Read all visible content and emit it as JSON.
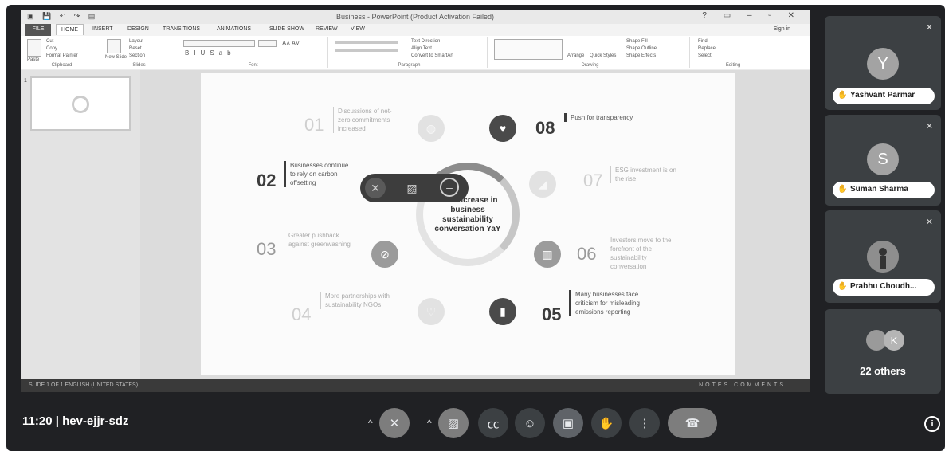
{
  "ppt": {
    "title": "Business - PowerPoint (Product Activation Failed)",
    "tabs": [
      "FILE",
      "HOME",
      "INSERT",
      "DESIGN",
      "TRANSITIONS",
      "ANIMATIONS",
      "SLIDE SHOW",
      "REVIEW",
      "VIEW"
    ],
    "sign_in": "Sign in",
    "groups": {
      "clipboard": "Clipboard",
      "slides": "Slides",
      "font": "Font",
      "paragraph": "Paragraph",
      "drawing": "Drawing",
      "editing": "Editing"
    },
    "buttons": {
      "cut": "Cut",
      "copy": "Copy",
      "format_painter": "Format Painter",
      "paste": "Paste",
      "new_slide": "New Slide",
      "layout": "Layout",
      "reset": "Reset",
      "section": "Section",
      "text_direction": "Text Direction",
      "align_text": "Align Text",
      "convert_smartart": "Convert to SmartArt",
      "arrange": "Arrange",
      "quick_styles": "Quick Styles",
      "shape_fill": "Shape Fill",
      "shape_outline": "Shape Outline",
      "shape_effects": "Shape Effects",
      "find": "Find",
      "replace": "Replace",
      "select": "Select"
    },
    "thumb_number": "1",
    "status_left": "SLIDE 1 OF 1   ENGLISH (UNITED STATES)",
    "status_right": "NOTES  COMMENTS"
  },
  "slide": {
    "center": "50% increase in business sustainability conversation YaY",
    "items": [
      {
        "num": "01",
        "text": "Discussions of net-zero commitments increased"
      },
      {
        "num": "02",
        "text": "Businesses continue to rely on carbon offsetting"
      },
      {
        "num": "03",
        "text": "Greater pushback against greenwashing"
      },
      {
        "num": "04",
        "text": "More partnerships with sustainability NGOs"
      },
      {
        "num": "05",
        "text": "Many businesses face criticism for misleading emissions reporting"
      },
      {
        "num": "06",
        "text": "Investors move to the forefront of the sustainability conversation"
      },
      {
        "num": "07",
        "text": "ESG investment is on the rise"
      },
      {
        "num": "08",
        "text": "Push for transparency"
      }
    ]
  },
  "participants": [
    {
      "initial": "Y",
      "name": "Yashvant Parmar"
    },
    {
      "initial": "S",
      "name": "Suman Sharma"
    },
    {
      "initial": "",
      "name": "Prabhu Choudh..."
    }
  ],
  "others": {
    "initial": "K",
    "label": "22 others"
  },
  "meeting": {
    "time": "11:20",
    "code": "hev-ejjr-sdz"
  }
}
